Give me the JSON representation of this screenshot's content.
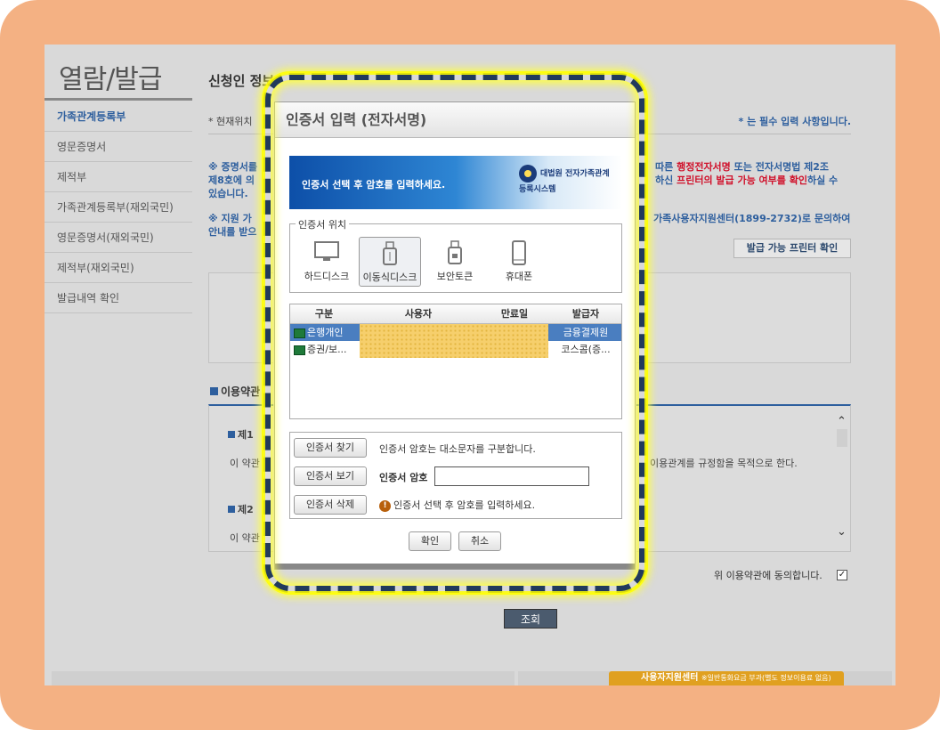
{
  "sidebar": {
    "title": "열람/발급",
    "items": [
      {
        "label": "가족관계등록부"
      },
      {
        "label": "영문증명서"
      },
      {
        "label": "제적부"
      },
      {
        "label": "가족관계등록부(재외국민)"
      },
      {
        "label": "영문증명서(재외국민)"
      },
      {
        "label": "제적부(재외국민)"
      },
      {
        "label": "발급내역 확인"
      }
    ]
  },
  "main": {
    "heading": "신청인 정보",
    "location": "* 현재위치",
    "required_note": "* 는 필수 입력 사항입니다.",
    "notice1_left_l1": "※ 증명서를",
    "notice1_left_l2": "제8호에 의",
    "notice1_left_l3": "있습니다.",
    "notice1_right_l1_a": "따른 ",
    "notice1_right_l1_red": "행정전자서명",
    "notice1_right_l1_b": " 또는 전자서명법 제2조",
    "notice1_right_l2_a": "하신 ",
    "notice1_right_l2_red": "프린터의 발급 가능 여부를 확인",
    "notice1_right_l2_b": "하실 수",
    "notice2_left_l1": "※ 지원 가",
    "notice2_left_l2": "안내를 받으",
    "notice2_right": "가족사용자지원센터(1899-2732)로 문의하여",
    "printer_button": "발급 가능 프린터 확인",
    "terms_heading": "이용약관",
    "terms_art1": "제1",
    "terms_text1_left": "이 약관",
    "terms_text1_right": "이용관계를 규정함을 목적으로 한다.",
    "terms_art2": "제2",
    "terms_text2_left": "이 약관",
    "agree_label": "위 이용약관에 동의합니다.",
    "agree_checked": "✓",
    "query_button": "조회",
    "support_label": "사용자지원센터",
    "support_note": "※일반통화요금 부과(별도 정보이용료 없음)"
  },
  "dialog": {
    "title": "인증서 입력 (전자서명)",
    "banner_message": "인증서 선택 후 암호를 입력하세요.",
    "banner_logo": "대법원 전자가족관계등록시스템",
    "location_legend": "인증서 위치",
    "locations": [
      {
        "label": "하드디스크",
        "icon": "monitor-icon"
      },
      {
        "label": "이동식디스크",
        "icon": "usb-drive-icon"
      },
      {
        "label": "보안토큰",
        "icon": "lock-token-icon"
      },
      {
        "label": "휴대폰",
        "icon": "mobile-phone-icon"
      }
    ],
    "table": {
      "headers": [
        "구분",
        "사용자",
        "만료일",
        "발급자"
      ],
      "rows": [
        {
          "type": "은행개인",
          "user": "",
          "expiry": "",
          "issuer": "금융결제원"
        },
        {
          "type": "증권/보...",
          "user": "",
          "expiry": "",
          "issuer": "코스콤(증..."
        }
      ],
      "partial_digit": "4"
    },
    "find_button": "인증서 찾기",
    "case_note": "인증서 암호는 대소문자를 구분합니다.",
    "view_button": "인증서 보기",
    "password_label": "인증서 암호",
    "password_value": "",
    "delete_button": "인증서 삭제",
    "warning_text": "인증서 선택 후 암호를 입력하세요.",
    "ok_button": "확인",
    "cancel_button": "취소"
  },
  "colors": {
    "frame": "#f4b183",
    "highlight_dash": "#213a5c",
    "highlight_glow": "#ffff40",
    "accent_blue": "#2e5f9e",
    "notice_red": "#d0102a",
    "selected_row": "#4a7ec0"
  }
}
